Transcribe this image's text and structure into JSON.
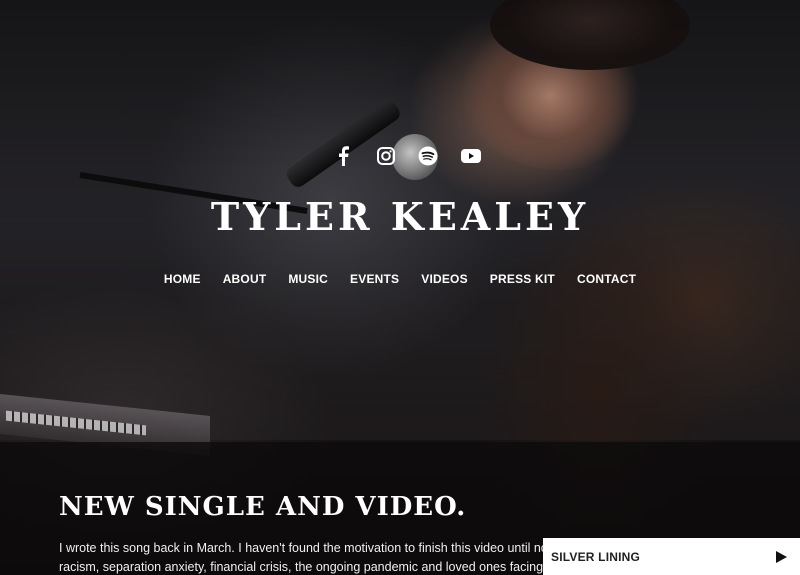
{
  "site": {
    "title": "TYLER KEALEY"
  },
  "social": [
    {
      "name": "facebook-icon"
    },
    {
      "name": "instagram-icon"
    },
    {
      "name": "spotify-icon"
    },
    {
      "name": "youtube-icon"
    }
  ],
  "nav": {
    "items": [
      {
        "label": "HOME"
      },
      {
        "label": "ABOUT"
      },
      {
        "label": "MUSIC"
      },
      {
        "label": "EVENTS"
      },
      {
        "label": "VIDEOS"
      },
      {
        "label": "PRESS KIT"
      },
      {
        "label": "CONTACT"
      }
    ]
  },
  "main": {
    "heading": "NEW SINGLE AND VIDEO.",
    "body_lines": [
      "I wrote this song back in March. I haven't found the motivation to finish this video until now.",
      "racism, separation anxiety, financial crisis, the ongoing pandemic and loved ones facing ca"
    ]
  },
  "player": {
    "track": "SILVER LINING",
    "play_icon": "play-icon"
  },
  "colors": {
    "text": "#ffffff",
    "band": "#0e0b0c",
    "player_bg": "#ffffff"
  }
}
